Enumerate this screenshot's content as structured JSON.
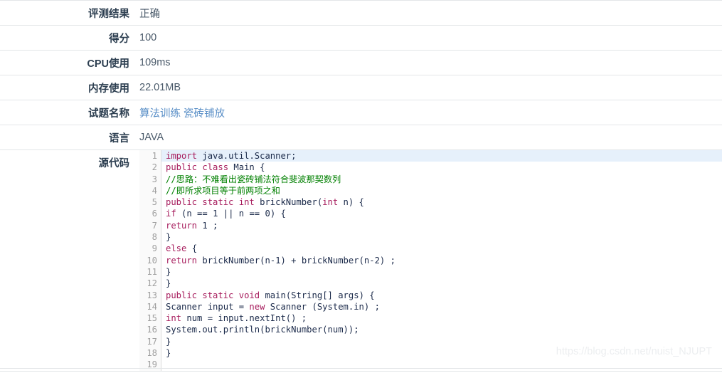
{
  "table": {
    "rows": [
      {
        "label": "评测结果",
        "value": "正确",
        "kind": "text"
      },
      {
        "label": "得分",
        "value": "100",
        "kind": "text"
      },
      {
        "label": "CPU使用",
        "value": "109ms",
        "kind": "text"
      },
      {
        "label": "内存使用",
        "value": "22.01MB",
        "kind": "text"
      },
      {
        "label": "试题名称",
        "value": "算法训练 瓷砖铺放",
        "kind": "link"
      },
      {
        "label": "语言",
        "value": "JAVA",
        "kind": "text"
      },
      {
        "label": "源代码",
        "value": "",
        "kind": "code"
      }
    ]
  },
  "source_code": {
    "label": "源代码",
    "highlight_line": 1,
    "lines": [
      {
        "n": "1",
        "text": "import java.util.Scanner;"
      },
      {
        "n": "2",
        "text": "public class Main {"
      },
      {
        "n": "3",
        "text": "//思路：不难看出瓷砖铺法符合斐波那契数列"
      },
      {
        "n": "4",
        "text": "//即所求项目等于前两项之和"
      },
      {
        "n": "5",
        "text": "public static int brickNumber(int n) {"
      },
      {
        "n": "6",
        "text": "if (n == 1 || n == 0) {"
      },
      {
        "n": "7",
        "text": "return 1 ;"
      },
      {
        "n": "8",
        "text": "}"
      },
      {
        "n": "9",
        "text": "else {"
      },
      {
        "n": "10",
        "text": "return brickNumber(n-1) + brickNumber(n-2) ;"
      },
      {
        "n": "11",
        "text": "}"
      },
      {
        "n": "12",
        "text": "}"
      },
      {
        "n": "13",
        "text": "public static void main(String[] args) {"
      },
      {
        "n": "14",
        "text": "Scanner input = new Scanner (System.in) ;"
      },
      {
        "n": "15",
        "text": "int num = input.nextInt() ;"
      },
      {
        "n": "16",
        "text": "System.out.println(brickNumber(num));"
      },
      {
        "n": "17",
        "text": "}"
      },
      {
        "n": "18",
        "text": "}"
      },
      {
        "n": "19",
        "text": ""
      }
    ],
    "language": "java",
    "keywords": [
      "import",
      "public",
      "class",
      "static",
      "int",
      "if",
      "return",
      "else",
      "new",
      "void"
    ]
  },
  "watermark": {
    "text": "https://blog.csdn.net/nuist_NJUPT"
  },
  "colors": {
    "keyword": "#a71d5d",
    "identifier": "#1b2a4a",
    "comment": "#008000",
    "link": "#5a8fc7",
    "label": "#2c3e50",
    "value": "#4a5a6a",
    "line_number": "#a0a0a0",
    "highlight_bg": "#e6f0fb",
    "row_border": "#e3e6e8",
    "watermark": "#eceef0"
  }
}
